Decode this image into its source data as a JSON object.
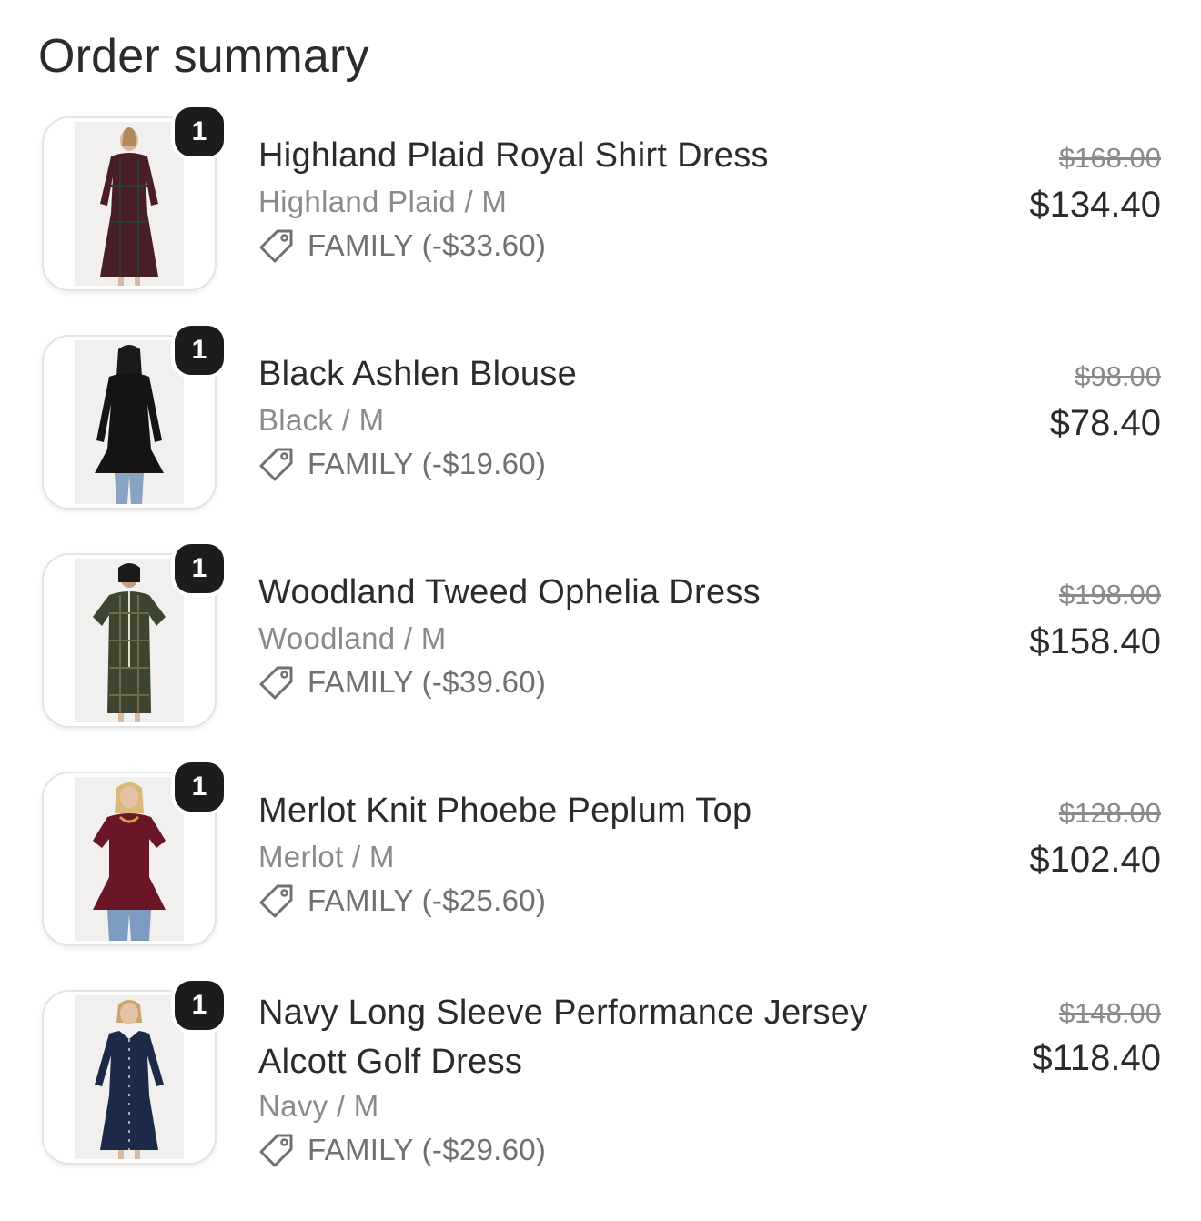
{
  "summary": {
    "title": "Order summary"
  },
  "items": [
    {
      "quantity": "1",
      "name": "Highland Plaid Royal Shirt Dress",
      "variant": "Highland Plaid / M",
      "discount": "FAMILY (-$33.60)",
      "original_price": "$168.00",
      "price": "$134.40",
      "image_colors": {
        "garment": "#4a1e26",
        "accent": "#2f3b2c",
        "legs": "#d9b8a0"
      }
    },
    {
      "quantity": "1",
      "name": "Black Ashlen Blouse",
      "variant": "Black / M",
      "discount": "FAMILY (-$19.60)",
      "original_price": "$98.00",
      "price": "$78.40",
      "image_colors": {
        "garment": "#141414",
        "accent": "#1f1f1f",
        "legs": "#8aa3c2"
      }
    },
    {
      "quantity": "1",
      "name": "Woodland Tweed Ophelia Dress",
      "variant": "Woodland / M",
      "discount": "FAMILY (-$39.60)",
      "original_price": "$198.00",
      "price": "$158.40",
      "image_colors": {
        "garment": "#3d4530",
        "accent": "#6e6a4a",
        "legs": "#d9b8a0"
      }
    },
    {
      "quantity": "1",
      "name": "Merlot Knit Phoebe Peplum Top",
      "variant": "Merlot / M",
      "discount": "FAMILY (-$25.60)",
      "original_price": "$128.00",
      "price": "$102.40",
      "image_colors": {
        "garment": "#6b1626",
        "accent": "#5a1220",
        "legs": "#7d9bc0"
      }
    },
    {
      "quantity": "1",
      "name": "Navy Long Sleeve Performance Jersey Alcott Golf Dress",
      "variant": "Navy / M",
      "discount": "FAMILY (-$29.60)",
      "original_price": "$148.00",
      "price": "$118.40",
      "image_colors": {
        "garment": "#1c2a48",
        "accent": "#f2f2f2",
        "legs": "#d9b8a0"
      }
    }
  ],
  "icons": {
    "discount": "tag-icon"
  },
  "colors": {
    "badge": "#1c1c1c",
    "muted_text": "#8a8a8a",
    "text": "#2b2b2b"
  }
}
